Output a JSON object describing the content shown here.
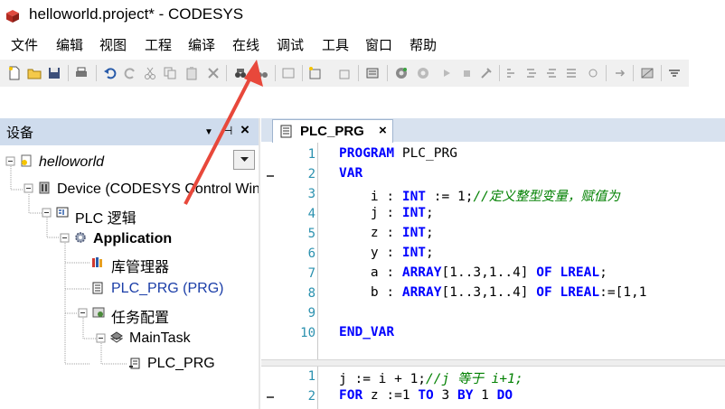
{
  "window": {
    "title": "helloworld.project* - CODESYS"
  },
  "menu": [
    "文件",
    "编辑",
    "视图",
    "工程",
    "编译",
    "在线",
    "调试",
    "工具",
    "窗口",
    "帮助"
  ],
  "devices_panel": {
    "title": "设备",
    "pin_glyph": "▼",
    "pushpin_glyph": "⊣",
    "close_glyph": "×",
    "tree": [
      {
        "label": "helloworld",
        "expander": "-",
        "style": "italic"
      },
      {
        "label": "Device (CODESYS Control Win",
        "expander": "-"
      },
      {
        "label": "PLC 逻辑",
        "expander": "-"
      },
      {
        "label": "Application",
        "expander": "-",
        "style": "bold"
      },
      {
        "label": "库管理器"
      },
      {
        "label": "PLC_PRG (PRG)",
        "style": "link"
      },
      {
        "label": "任务配置",
        "expander": "-"
      },
      {
        "label": "MainTask",
        "expander": "-"
      },
      {
        "label": "PLC_PRG"
      }
    ]
  },
  "editor": {
    "tab_label": "PLC_PRG",
    "tab_close": "×",
    "declaration_lines": [
      {
        "num": "1",
        "html": "PROGRAM PLC_PRG"
      },
      {
        "num": "2",
        "html": "VAR"
      },
      {
        "num": "3",
        "html": "    i : INT := 1;//定义整型变量，赋值为"
      },
      {
        "num": "4",
        "html": "    j : INT;"
      },
      {
        "num": "5",
        "html": "    z : INT;"
      },
      {
        "num": "6",
        "html": "    y : INT;"
      },
      {
        "num": "7",
        "html": "    a : ARRAY[1..3,1..4] OF LREAL;"
      },
      {
        "num": "8",
        "html": "    b : ARRAY[1..3,1..4] OF LREAL:=[1,1"
      },
      {
        "num": "9",
        "html": ""
      },
      {
        "num": "10",
        "html": "END_VAR"
      }
    ],
    "implementation_lines": [
      {
        "num": "1",
        "html": "j := i + 1;//j 等于 i+1;"
      },
      {
        "num": "2",
        "html": "FOR z :=1 TO 3 BY 1 DO"
      }
    ]
  },
  "colors": {
    "panel_header": "#cfdced",
    "keyword": "#0000ff",
    "comment": "#008000",
    "line_number": "#2b91af",
    "arrow": "#e8483b"
  }
}
